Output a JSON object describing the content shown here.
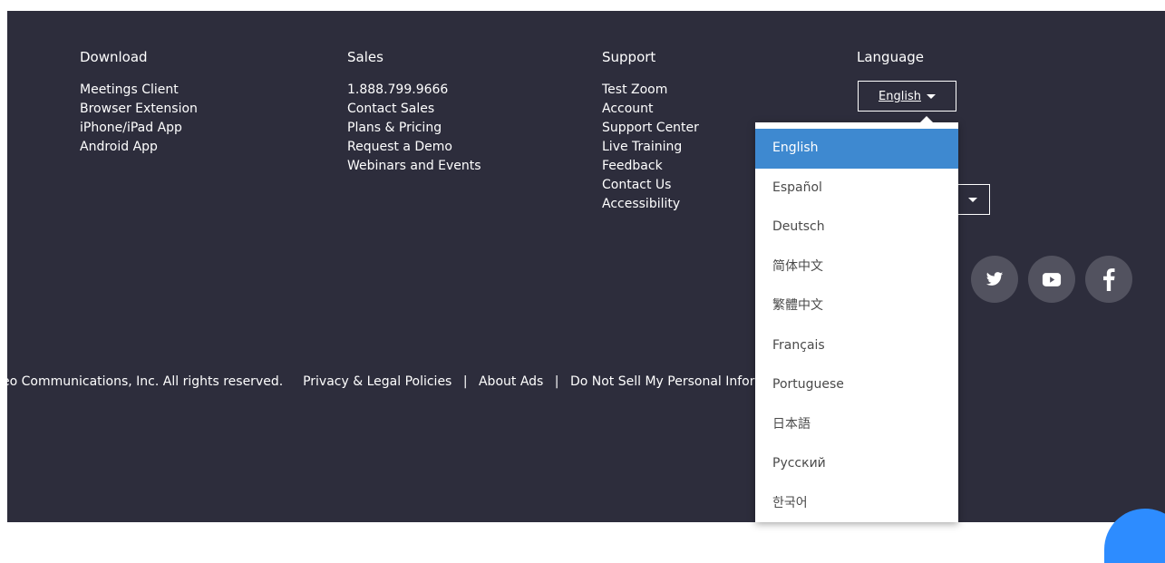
{
  "columns": [
    {
      "title": "Download",
      "items": [
        "Meetings Client",
        "Browser Extension",
        "iPhone/iPad App",
        "Android App"
      ]
    },
    {
      "title": "Sales",
      "items": [
        "1.888.799.9666",
        "Contact Sales",
        "Plans & Pricing",
        "Request a Demo",
        "Webinars and Events"
      ]
    },
    {
      "title": "Support",
      "items": [
        "Test Zoom",
        "Account",
        "Support Center",
        "Live Training",
        "Feedback",
        "Contact Us",
        "Accessibility"
      ]
    },
    {
      "title": "Language"
    }
  ],
  "language": {
    "selected": "English",
    "options": [
      "English",
      "Español",
      "Deutsch",
      "简体中文",
      "繁體中文",
      "Français",
      "Portuguese",
      "日本語",
      "Русский",
      "한국어"
    ]
  },
  "social": [
    "twitter-icon",
    "youtube-icon",
    "facebook-icon"
  ],
  "bottom": {
    "copyright": "eo Communications, Inc. All rights reserved.",
    "links": [
      "Privacy & Legal Policies",
      "About Ads",
      "Do Not Sell My Personal Information"
    ]
  },
  "colors": {
    "footer_bg": "#2d2d3c",
    "selected_bg": "#3e89d0",
    "accent": "#2d8cff"
  }
}
